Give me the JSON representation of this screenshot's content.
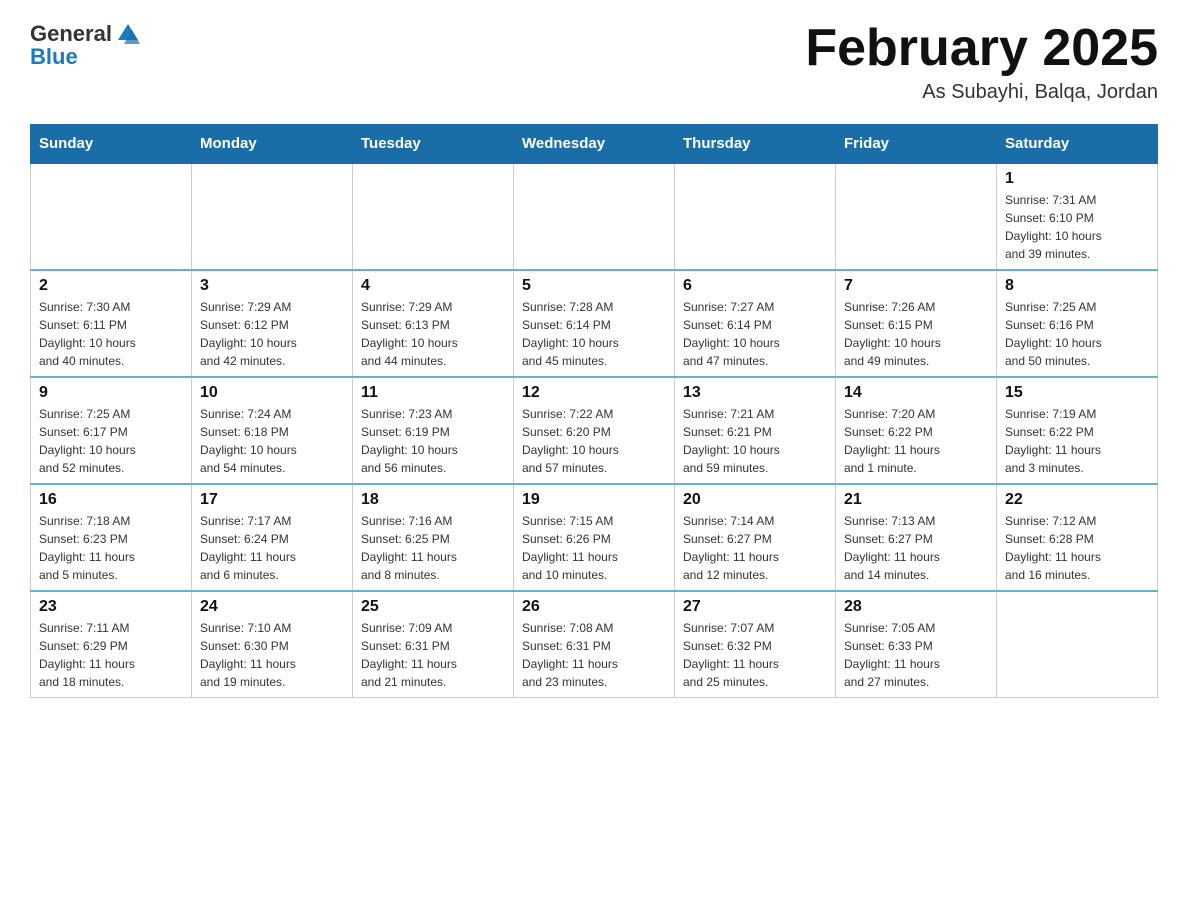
{
  "header": {
    "logo": {
      "general": "General",
      "blue": "Blue"
    },
    "title": "February 2025",
    "location": "As Subayhi, Balqa, Jordan"
  },
  "days_of_week": [
    "Sunday",
    "Monday",
    "Tuesday",
    "Wednesday",
    "Thursday",
    "Friday",
    "Saturday"
  ],
  "weeks": [
    [
      {
        "day": "",
        "info": ""
      },
      {
        "day": "",
        "info": ""
      },
      {
        "day": "",
        "info": ""
      },
      {
        "day": "",
        "info": ""
      },
      {
        "day": "",
        "info": ""
      },
      {
        "day": "",
        "info": ""
      },
      {
        "day": "1",
        "info": "Sunrise: 7:31 AM\nSunset: 6:10 PM\nDaylight: 10 hours\nand 39 minutes."
      }
    ],
    [
      {
        "day": "2",
        "info": "Sunrise: 7:30 AM\nSunset: 6:11 PM\nDaylight: 10 hours\nand 40 minutes."
      },
      {
        "day": "3",
        "info": "Sunrise: 7:29 AM\nSunset: 6:12 PM\nDaylight: 10 hours\nand 42 minutes."
      },
      {
        "day": "4",
        "info": "Sunrise: 7:29 AM\nSunset: 6:13 PM\nDaylight: 10 hours\nand 44 minutes."
      },
      {
        "day": "5",
        "info": "Sunrise: 7:28 AM\nSunset: 6:14 PM\nDaylight: 10 hours\nand 45 minutes."
      },
      {
        "day": "6",
        "info": "Sunrise: 7:27 AM\nSunset: 6:14 PM\nDaylight: 10 hours\nand 47 minutes."
      },
      {
        "day": "7",
        "info": "Sunrise: 7:26 AM\nSunset: 6:15 PM\nDaylight: 10 hours\nand 49 minutes."
      },
      {
        "day": "8",
        "info": "Sunrise: 7:25 AM\nSunset: 6:16 PM\nDaylight: 10 hours\nand 50 minutes."
      }
    ],
    [
      {
        "day": "9",
        "info": "Sunrise: 7:25 AM\nSunset: 6:17 PM\nDaylight: 10 hours\nand 52 minutes."
      },
      {
        "day": "10",
        "info": "Sunrise: 7:24 AM\nSunset: 6:18 PM\nDaylight: 10 hours\nand 54 minutes."
      },
      {
        "day": "11",
        "info": "Sunrise: 7:23 AM\nSunset: 6:19 PM\nDaylight: 10 hours\nand 56 minutes."
      },
      {
        "day": "12",
        "info": "Sunrise: 7:22 AM\nSunset: 6:20 PM\nDaylight: 10 hours\nand 57 minutes."
      },
      {
        "day": "13",
        "info": "Sunrise: 7:21 AM\nSunset: 6:21 PM\nDaylight: 10 hours\nand 59 minutes."
      },
      {
        "day": "14",
        "info": "Sunrise: 7:20 AM\nSunset: 6:22 PM\nDaylight: 11 hours\nand 1 minute."
      },
      {
        "day": "15",
        "info": "Sunrise: 7:19 AM\nSunset: 6:22 PM\nDaylight: 11 hours\nand 3 minutes."
      }
    ],
    [
      {
        "day": "16",
        "info": "Sunrise: 7:18 AM\nSunset: 6:23 PM\nDaylight: 11 hours\nand 5 minutes."
      },
      {
        "day": "17",
        "info": "Sunrise: 7:17 AM\nSunset: 6:24 PM\nDaylight: 11 hours\nand 6 minutes."
      },
      {
        "day": "18",
        "info": "Sunrise: 7:16 AM\nSunset: 6:25 PM\nDaylight: 11 hours\nand 8 minutes."
      },
      {
        "day": "19",
        "info": "Sunrise: 7:15 AM\nSunset: 6:26 PM\nDaylight: 11 hours\nand 10 minutes."
      },
      {
        "day": "20",
        "info": "Sunrise: 7:14 AM\nSunset: 6:27 PM\nDaylight: 11 hours\nand 12 minutes."
      },
      {
        "day": "21",
        "info": "Sunrise: 7:13 AM\nSunset: 6:27 PM\nDaylight: 11 hours\nand 14 minutes."
      },
      {
        "day": "22",
        "info": "Sunrise: 7:12 AM\nSunset: 6:28 PM\nDaylight: 11 hours\nand 16 minutes."
      }
    ],
    [
      {
        "day": "23",
        "info": "Sunrise: 7:11 AM\nSunset: 6:29 PM\nDaylight: 11 hours\nand 18 minutes."
      },
      {
        "day": "24",
        "info": "Sunrise: 7:10 AM\nSunset: 6:30 PM\nDaylight: 11 hours\nand 19 minutes."
      },
      {
        "day": "25",
        "info": "Sunrise: 7:09 AM\nSunset: 6:31 PM\nDaylight: 11 hours\nand 21 minutes."
      },
      {
        "day": "26",
        "info": "Sunrise: 7:08 AM\nSunset: 6:31 PM\nDaylight: 11 hours\nand 23 minutes."
      },
      {
        "day": "27",
        "info": "Sunrise: 7:07 AM\nSunset: 6:32 PM\nDaylight: 11 hours\nand 25 minutes."
      },
      {
        "day": "28",
        "info": "Sunrise: 7:05 AM\nSunset: 6:33 PM\nDaylight: 11 hours\nand 27 minutes."
      },
      {
        "day": "",
        "info": ""
      }
    ]
  ]
}
